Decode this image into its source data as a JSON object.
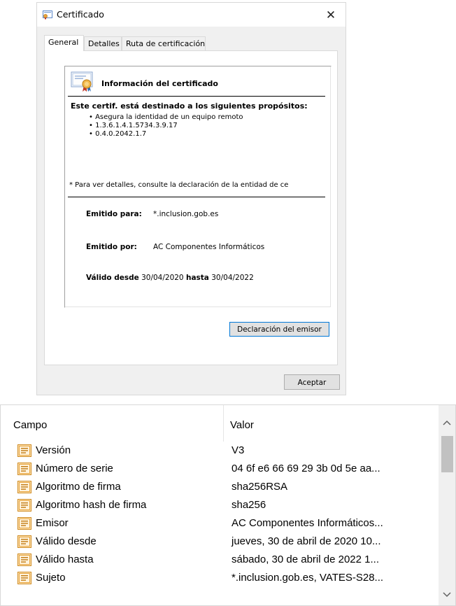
{
  "dialog": {
    "title": "Certificado",
    "close_glyph": "✕",
    "tabs": [
      "General",
      "Detalles",
      "Ruta de certificación"
    ],
    "info_title": "Información del certificado",
    "purposes_heading": "Este certif. está destinado a los siguientes propósitos:",
    "purposes": [
      "Asegura la identidad de un equipo remoto",
      "1.3.6.1.4.1.5734.3.9.17",
      "0.4.0.2042.1.7"
    ],
    "footnote": "* Para ver detalles, consulte la declaración de la entidad de ce",
    "issued_to_label": "Emitido para:",
    "issued_to_value": "*.inclusion.gob.es",
    "issued_by_label": "Emitido por:",
    "issued_by_value": "AC Componentes Informáticos",
    "valid_from_label": "Válido desde",
    "valid_from_value": "30/04/2020",
    "valid_to_label": "hasta",
    "valid_to_value": "30/04/2022",
    "issuer_statement_button": "Declaración del emisor",
    "accept_button": "Aceptar"
  },
  "details_list": {
    "columns": [
      "Campo",
      "Valor"
    ],
    "rows": [
      {
        "field": "Versión",
        "value": "V3"
      },
      {
        "field": "Número de serie",
        "value": "04 6f e6 66 69 29 3b 0d 5e aa..."
      },
      {
        "field": "Algoritmo de firma",
        "value": "sha256RSA"
      },
      {
        "field": "Algoritmo hash de firma",
        "value": "sha256"
      },
      {
        "field": "Emisor",
        "value": "AC Componentes Informáticos..."
      },
      {
        "field": "Válido desde",
        "value": "jueves, 30 de abril de 2020 10..."
      },
      {
        "field": "Válido hasta",
        "value": "sábado, 30 de abril de 2022 1..."
      },
      {
        "field": "Sujeto",
        "value": "*.inclusion.gob.es, VATES-S28..."
      }
    ]
  },
  "icons": {
    "title": "certificate-icon",
    "info": "certificate-ribbon-icon",
    "row": "certificate-field-icon",
    "scroll_up": "chevron-up-icon",
    "scroll_down": "chevron-down-icon"
  },
  "colors": {
    "dialog_bg": "#f0f0f0",
    "focus_border": "#0078d7",
    "icon_orange": "#e8a33c"
  }
}
